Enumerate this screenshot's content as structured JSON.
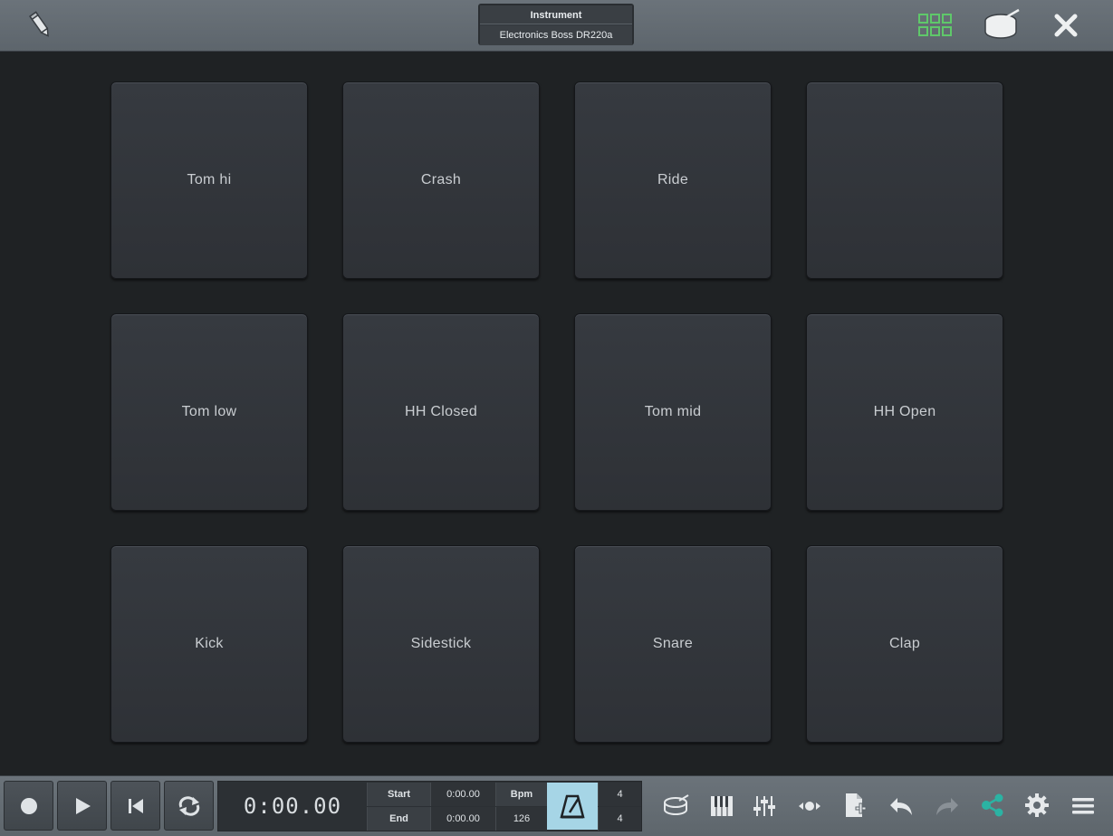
{
  "header": {
    "instrument_label": "Instrument",
    "instrument_name": "Electronics Boss DR220a",
    "icons": {
      "edit": "pencil-icon",
      "pads_view": "grid-icon",
      "drum": "drum-icon",
      "close": "close-icon"
    },
    "accent_green": "#5fc86a"
  },
  "pads": [
    {
      "label": "Tom hi"
    },
    {
      "label": "Crash"
    },
    {
      "label": "Ride"
    },
    {
      "label": ""
    },
    {
      "label": "Tom low"
    },
    {
      "label": "HH Closed"
    },
    {
      "label": "Tom mid"
    },
    {
      "label": "HH Open"
    },
    {
      "label": "Kick"
    },
    {
      "label": "Sidestick"
    },
    {
      "label": "Snare"
    },
    {
      "label": "Clap"
    }
  ],
  "transport": {
    "time": "0:00.00",
    "start_label": "Start",
    "start_value": "0:00.00",
    "end_label": "End",
    "end_value": "0:00.00",
    "bpm_label": "Bpm",
    "bpm_value": "126",
    "time_sig_top": "4",
    "time_sig_bottom": "4",
    "metronome_color": "#a6d5e6"
  },
  "toolbar_icons": [
    "record-icon",
    "play-icon",
    "rewind-icon",
    "loop-icon",
    "drum-icon",
    "piano-icon",
    "mixer-icon",
    "automation-icon",
    "new-file-icon",
    "undo-icon",
    "redo-icon",
    "share-icon",
    "settings-icon",
    "menu-icon"
  ],
  "share_color": "#2bb3a3"
}
